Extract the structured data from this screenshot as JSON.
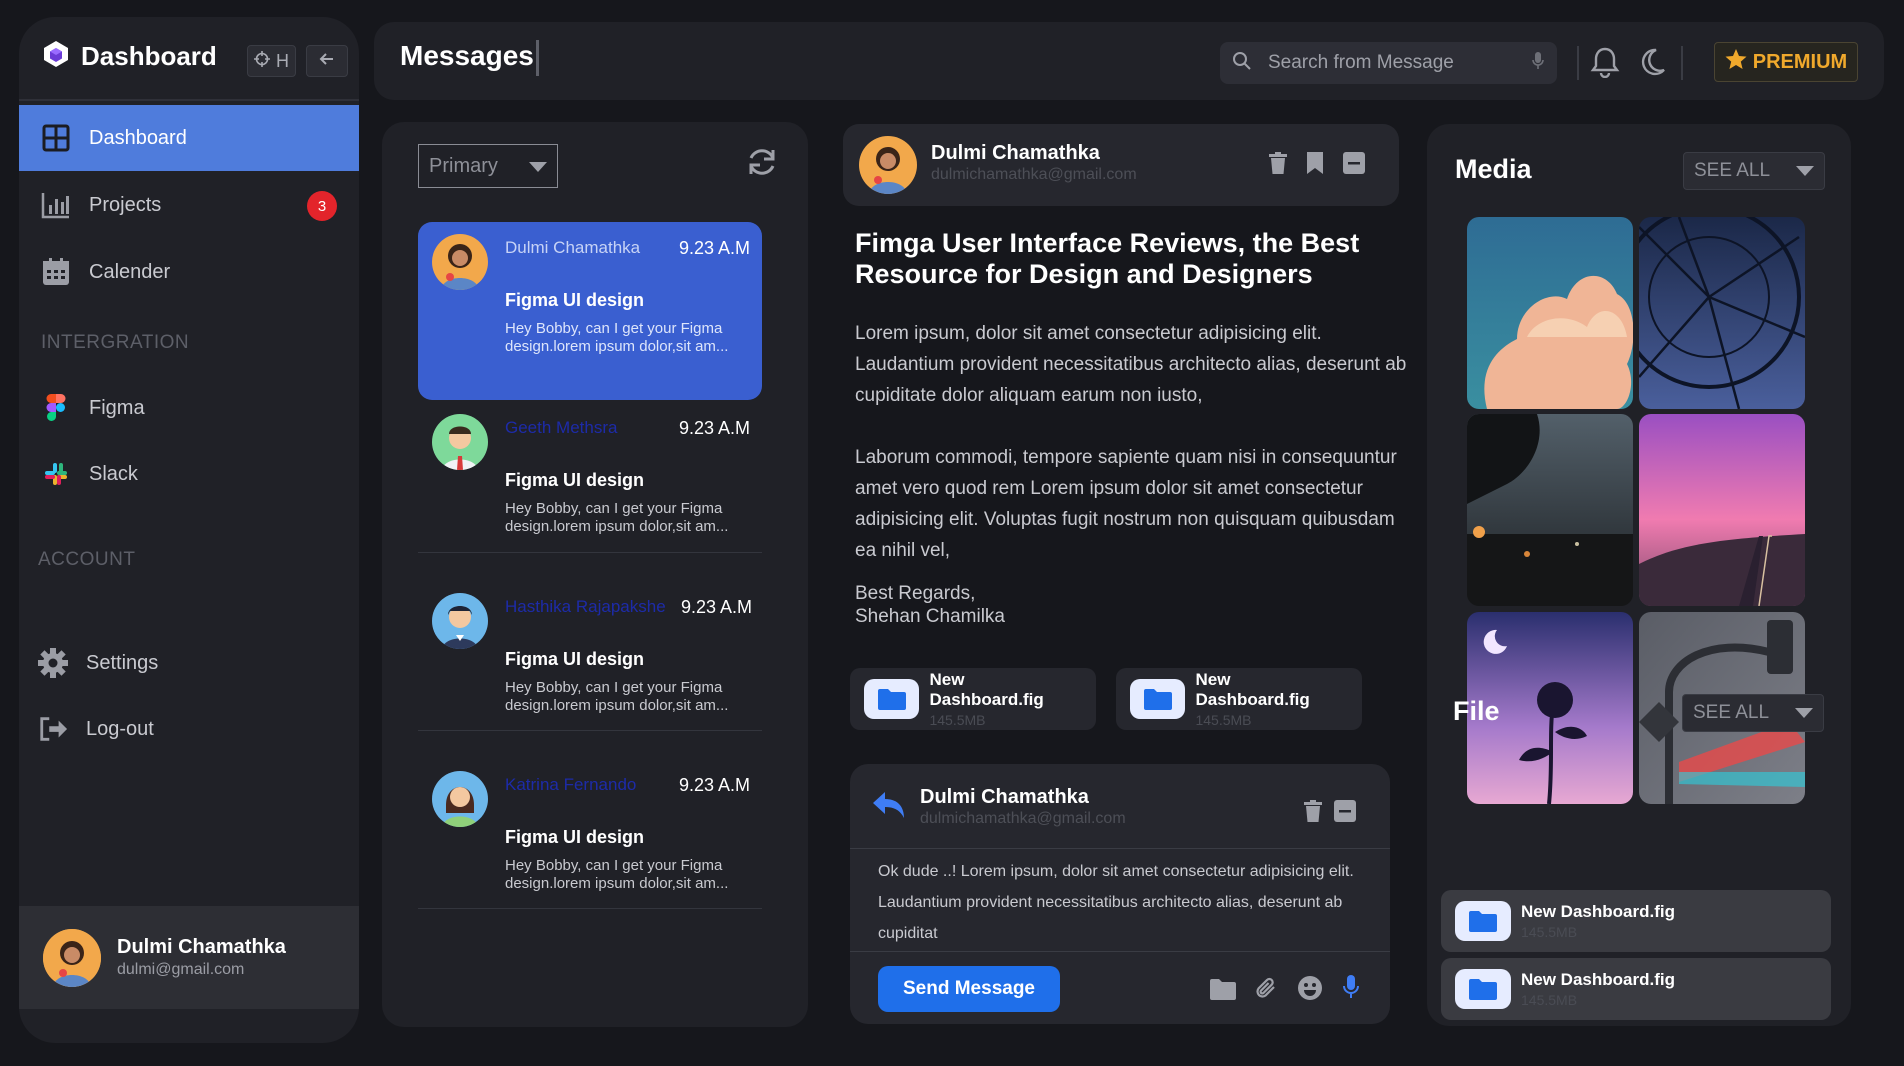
{
  "sidebar": {
    "brand": "Dashboard",
    "collapse_key": "H",
    "items": [
      {
        "label": "Dashboard",
        "icon": "grid-icon",
        "active": true
      },
      {
        "label": "Projects",
        "icon": "bar-chart-icon",
        "badge": "3"
      },
      {
        "label": "Calender",
        "icon": "calendar-icon"
      }
    ],
    "integration_label": "INTERGRATION",
    "integrations": [
      {
        "label": "Figma",
        "icon": "figma-icon"
      },
      {
        "label": "Slack",
        "icon": "slack-icon"
      }
    ],
    "account_label": "ACCOUNT",
    "account_items": [
      {
        "label": "Settings",
        "icon": "gear-icon"
      },
      {
        "label": "Log-out",
        "icon": "logout-icon"
      }
    ],
    "user": {
      "name": "Dulmi Chamathka",
      "email": "dulmi@gmail.com"
    }
  },
  "header": {
    "title": "Messages",
    "search_placeholder": "Search from Message",
    "premium_label": "PREMIUM"
  },
  "inbox": {
    "filter": "Primary",
    "messages": [
      {
        "sender": "Dulmi Chamathka",
        "time": "9.23 A.M",
        "subject": "Figma UI design",
        "preview": "Hey Bobby, can I get your Figma design.lorem ipsum dolor,sit am...",
        "active": true
      },
      {
        "sender": "Geeth Methsra",
        "time": "9.23 A.M",
        "subject": "Figma UI design",
        "preview": "Hey Bobby, can I get your Figma design.lorem ipsum dolor,sit am..."
      },
      {
        "sender": "Hasthika Rajapakshe",
        "time": "9.23 A.M",
        "subject": "Figma UI design",
        "preview": "Hey Bobby, can I get your Figma design.lorem ipsum dolor,sit am..."
      },
      {
        "sender": "Katrina Fernando",
        "time": "9.23 A.M",
        "subject": "Figma UI design",
        "preview": "Hey Bobby, can I get your Figma design.lorem ipsum dolor,sit am..."
      }
    ]
  },
  "detail": {
    "sender_name": "Dulmi Chamathka",
    "sender_email": "dulmichamathka@gmail.com",
    "headline": "Fimga User Interface Reviews, the Best Resource for Design and Designers",
    "para1": "Lorem ipsum, dolor sit amet consectetur adipisicing elit. Laudantium provident necessitatibus architecto alias, deserunt ab cupiditate dolor aliquam earum non iusto,",
    "para2": "Laborum commodi, tempore sapiente quam nisi in consequuntur amet vero quod rem Lorem ipsum dolor sit amet consectetur adipisicing elit. Voluptas fugit nostrum non quisquam quibusdam ea nihil vel,",
    "regards": "Best Regards,",
    "signature": "Shehan Chamilka",
    "attachments": [
      {
        "name": "New Dashboard.fig",
        "size": "145.5MB"
      },
      {
        "name": "New Dashboard.fig",
        "size": "145.5MB"
      }
    ]
  },
  "reply": {
    "sender_name": "Dulmi Chamathka",
    "sender_email": "dulmichamathka@gmail.com",
    "body": "Ok dude ..!  Lorem ipsum, dolor sit amet consectetur adipisicing elit. Laudantium provident necessitatibus architecto alias, deserunt ab cupiditat",
    "send_label": "Send Message"
  },
  "media": {
    "title": "Media",
    "see_all": "SEE ALL"
  },
  "files": {
    "title": "File",
    "see_all": "SEE ALL",
    "items": [
      {
        "name": "New Dashboard.fig",
        "size": "145.5MB"
      },
      {
        "name": "New Dashboard.fig",
        "size": "145.5MB"
      }
    ]
  },
  "colors": {
    "accent": "#4f7cdc",
    "active_message": "#3a5fd0",
    "send": "#1f6fea",
    "premium": "#f0a92c",
    "badge": "#e3242b"
  }
}
